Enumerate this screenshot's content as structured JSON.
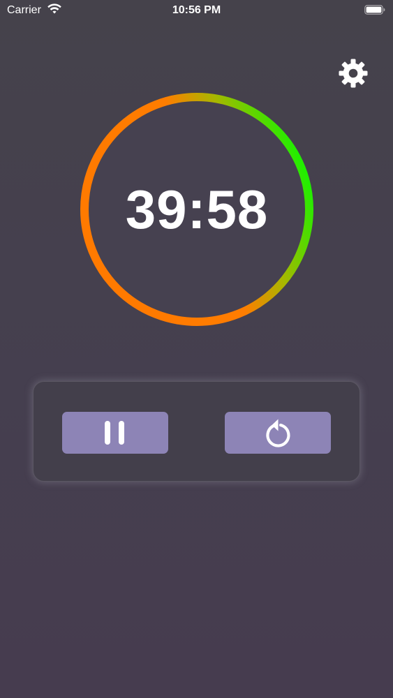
{
  "status_bar": {
    "carrier": "Carrier",
    "time": "10:56 PM",
    "icons": [
      "wifi-icon",
      "battery-icon"
    ]
  },
  "settings": {
    "icon": "gear-icon"
  },
  "timer": {
    "display": "39:58",
    "ring_colors": [
      "#ff7a00",
      "#22ee00"
    ]
  },
  "controls": {
    "pause": {
      "icon": "pause-icon"
    },
    "reset": {
      "icon": "restart-icon"
    },
    "button_color": "#8d84b6"
  },
  "colors": {
    "background": "#453f4f",
    "text": "#ffffff"
  }
}
